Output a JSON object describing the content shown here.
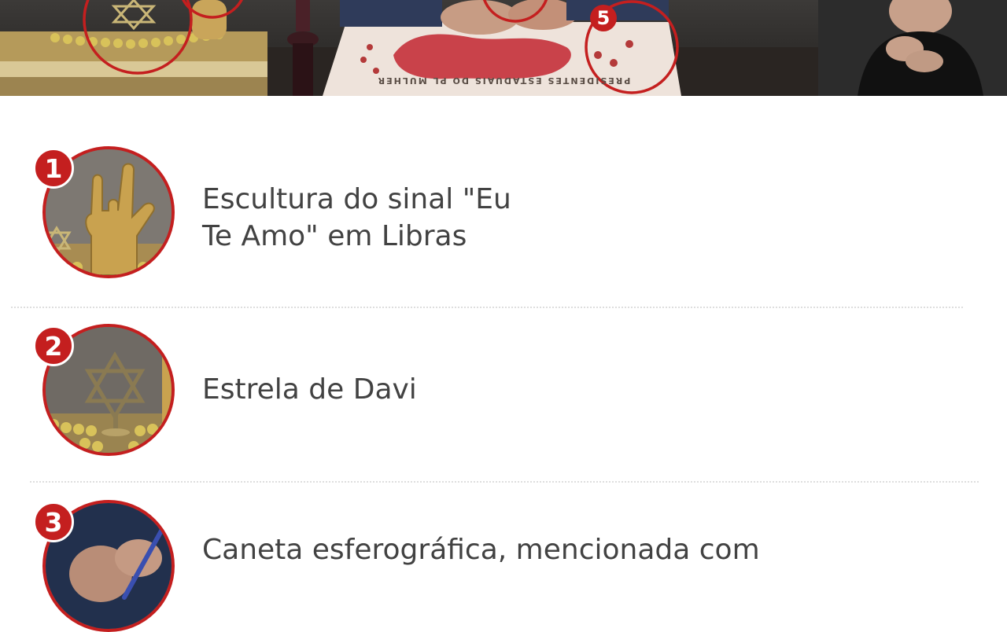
{
  "banner": {
    "badge_number": "5",
    "map_caption": "PRESIDENTES ESTADUAIS DO PL MULHER",
    "accent_color": "#c41f1f"
  },
  "items": [
    {
      "number": "1",
      "title": "Escultura do sinal \"Eu Te Amo\" em Libras",
      "line1": "Escultura do sinal \"Eu",
      "line2": "Te Amo\" em Libras",
      "thumb_icon": "gold-hand-sculpture-icon"
    },
    {
      "number": "2",
      "title": "Estrela de Davi",
      "thumb_icon": "star-of-david-icon"
    },
    {
      "number": "3",
      "title": "Caneta esferográfica, mencionada com",
      "thumb_icon": "pen-in-hand-icon"
    }
  ],
  "colors": {
    "accent": "#c41f1f",
    "text": "#424242",
    "divider": "#dedede",
    "background": "#ffffff"
  }
}
